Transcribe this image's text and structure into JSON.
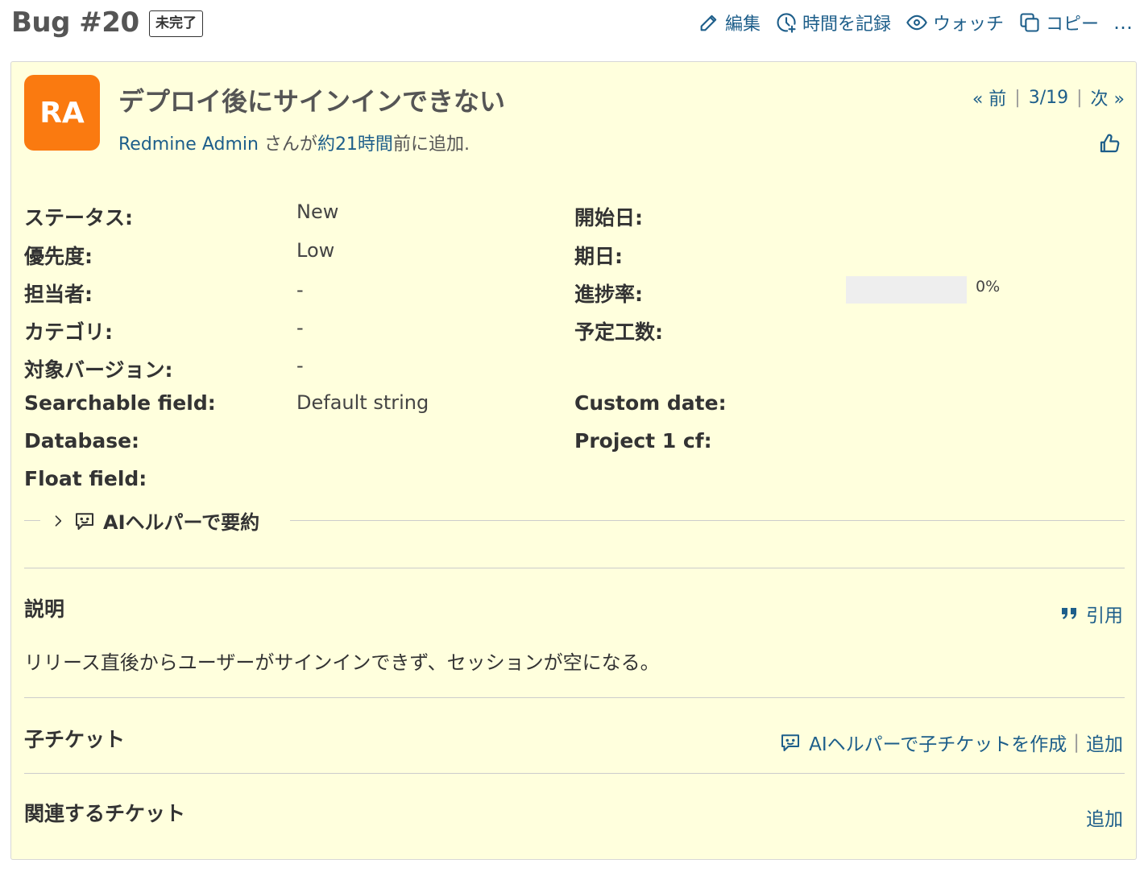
{
  "header": {
    "title": "Bug #20",
    "status_badge": "未完了",
    "actions": {
      "edit": "編集",
      "log_time": "時間を記録",
      "watch": "ウォッチ",
      "copy": "コピー",
      "more": "…"
    }
  },
  "issue": {
    "avatar_initials": "RA",
    "subject": "デプロイ後にサインインできない",
    "author": "Redmine Admin",
    "author_suffix": " さんが",
    "age": "約21時間",
    "added_suffix": "前に追加.",
    "nav": {
      "prev": "« 前",
      "position": "3/19",
      "next": "次 »"
    }
  },
  "attributes": {
    "status_label": "ステータス:",
    "status_value": "New",
    "priority_label": "優先度:",
    "priority_value": "Low",
    "assignee_label": "担当者:",
    "assignee_value": "-",
    "category_label": "カテゴリ:",
    "category_value": "-",
    "version_label": "対象バージョン:",
    "version_value": "-",
    "searchable_label": "Searchable field:",
    "searchable_value": "Default string",
    "database_label": "Database:",
    "float_label": "Float field:",
    "start_date_label": "開始日:",
    "due_date_label": "期日:",
    "progress_label": "進捗率:",
    "progress_value": "0%",
    "progress_fraction": 0,
    "estimated_label": "予定工数:",
    "custom_date_label": "Custom date:",
    "project_cf_label": "Project 1 cf:"
  },
  "ai_summary": {
    "label": "AIヘルパーで要約"
  },
  "description": {
    "title": "説明",
    "quote": "引用",
    "text": "リリース直後からユーザーがサインインできず、セッションが空になる。"
  },
  "subtasks": {
    "title": "子チケット",
    "ai_create": "AIヘルパーで子チケットを作成",
    "sep": "|",
    "add": "追加"
  },
  "relations": {
    "title": "関連するチケット",
    "add": "追加"
  },
  "colors": {
    "link": "#1d5e8a",
    "issue_bg": "#ffffdd",
    "avatar_bg": "#fa7a10"
  }
}
